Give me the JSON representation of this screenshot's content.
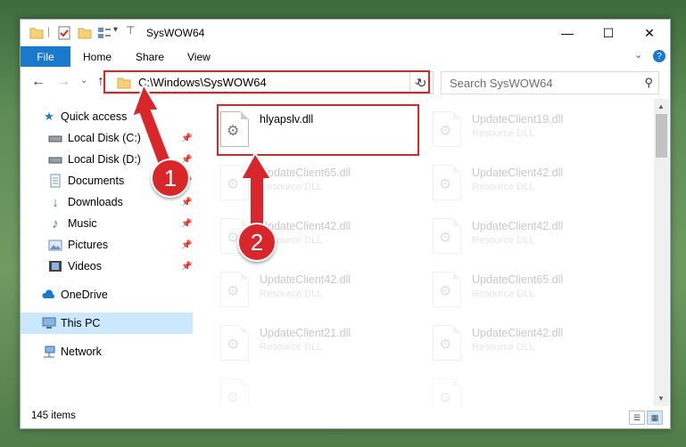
{
  "window": {
    "title": "SysWOW64",
    "controls": {
      "minimize": "—",
      "maximize": "☐",
      "close": "✕"
    }
  },
  "ribbon": {
    "file_tab": "File",
    "tabs": [
      "Home",
      "Share",
      "View"
    ],
    "collapse_icon": "chevron-down-icon",
    "help_icon": "?"
  },
  "address_bar": {
    "path": "C:\\Windows\\SysWOW64",
    "search_placeholder": "Search SysWOW64"
  },
  "sidebar": {
    "items": [
      {
        "label": "Quick access",
        "icon": "star-icon",
        "pinned": false
      },
      {
        "label": "Local Disk (C:)",
        "icon": "drive-icon",
        "pinned": true
      },
      {
        "label": "Local Disk (D:)",
        "icon": "drive-icon",
        "pinned": true
      },
      {
        "label": "Documents",
        "icon": "documents-icon",
        "pinned": true
      },
      {
        "label": "Downloads",
        "icon": "downloads-icon",
        "pinned": true
      },
      {
        "label": "Music",
        "icon": "music-icon",
        "pinned": true
      },
      {
        "label": "Pictures",
        "icon": "pictures-icon",
        "pinned": true
      },
      {
        "label": "Videos",
        "icon": "videos-icon",
        "pinned": true
      },
      {
        "label": "OneDrive",
        "icon": "cloud-icon",
        "pinned": false
      },
      {
        "label": "This PC",
        "icon": "computer-icon",
        "pinned": false,
        "selected": true
      },
      {
        "label": "Network",
        "icon": "network-icon",
        "pinned": false
      }
    ]
  },
  "files": [
    {
      "name": "hlyapslv.dll",
      "type": "",
      "highlighted": true
    },
    {
      "name": "UpdateClient19.dll",
      "type": "Resource DLL"
    },
    {
      "name": "UpdateClient65.dll",
      "type": "Resource DLL"
    },
    {
      "name": "UpdateClient42.dll",
      "type": "Resource DLL"
    },
    {
      "name": "UpdateClient42.dll",
      "type": "Resource DLL"
    },
    {
      "name": "UpdateClient42.dll",
      "type": "Resource DLL"
    },
    {
      "name": "UpdateClient42.dll",
      "type": "Resource DLL"
    },
    {
      "name": "UpdateClient65.dll",
      "type": "Resource DLL"
    },
    {
      "name": "UpdateClient21.dll",
      "type": "Resource DLL"
    },
    {
      "name": "UpdateClient42.dll",
      "type": "Resource DLL"
    }
  ],
  "status": {
    "item_count": "145 items"
  },
  "annotations": {
    "step1": "1",
    "step2": "2",
    "color": "#d9262b"
  }
}
